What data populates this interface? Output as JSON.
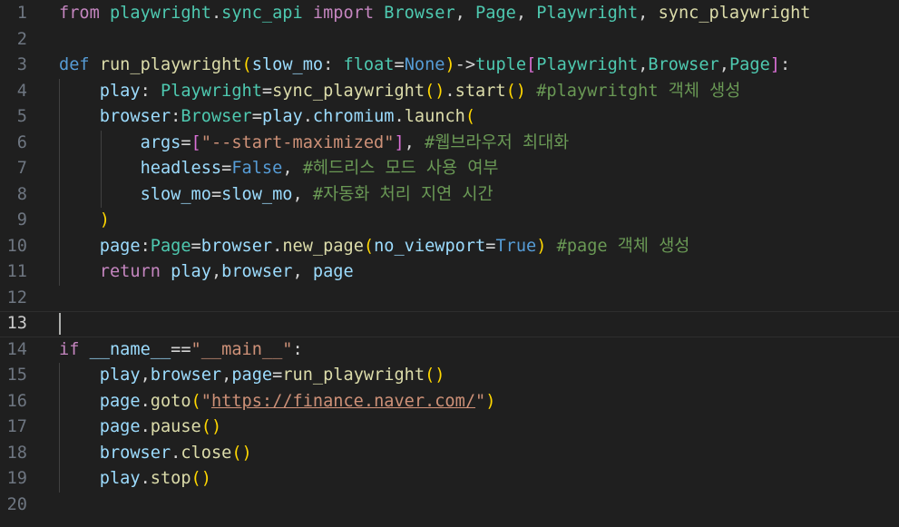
{
  "editor": {
    "language": "python",
    "active_line": 13,
    "colors": {
      "background": "#1f1f1f",
      "line_number": "#6e7681",
      "keyword_control": "#c586c0",
      "keyword": "#569cd6",
      "function": "#dcdcaa",
      "class": "#4ec9b0",
      "variable": "#9cdcfe",
      "string": "#ce9178",
      "comment": "#6a9955"
    },
    "lines": [
      {
        "n": "1",
        "tokens": [
          [
            "kw",
            "from"
          ],
          [
            "pl",
            " "
          ],
          [
            "ty",
            "playwright"
          ],
          [
            "pl",
            "."
          ],
          [
            "ty",
            "sync_api"
          ],
          [
            "pl",
            " "
          ],
          [
            "kw",
            "import"
          ],
          [
            "pl",
            " "
          ],
          [
            "ty",
            "Browser"
          ],
          [
            "pl",
            ", "
          ],
          [
            "ty",
            "Page"
          ],
          [
            "pl",
            ", "
          ],
          [
            "ty",
            "Playwright"
          ],
          [
            "pl",
            ", "
          ],
          [
            "fn",
            "sync_playwright"
          ]
        ]
      },
      {
        "n": "2",
        "tokens": []
      },
      {
        "n": "3",
        "tokens": [
          [
            "st",
            "def"
          ],
          [
            "pl",
            " "
          ],
          [
            "fn",
            "run_playwright"
          ],
          [
            "b1",
            "("
          ],
          [
            "va",
            "slow_mo"
          ],
          [
            "pl",
            ": "
          ],
          [
            "ty",
            "float"
          ],
          [
            "pl",
            "="
          ],
          [
            "st",
            "None"
          ],
          [
            "b1",
            ")"
          ],
          [
            "pl",
            "->"
          ],
          [
            "ty",
            "tuple"
          ],
          [
            "b2",
            "["
          ],
          [
            "ty",
            "Playwright"
          ],
          [
            "pl",
            ","
          ],
          [
            "ty",
            "Browser"
          ],
          [
            "pl",
            ","
          ],
          [
            "ty",
            "Page"
          ],
          [
            "b2",
            "]"
          ],
          [
            "pl",
            ":"
          ]
        ]
      },
      {
        "n": "4",
        "tokens": [
          [
            "pl",
            "    "
          ],
          [
            "va",
            "play"
          ],
          [
            "pl",
            ": "
          ],
          [
            "ty",
            "Playwright"
          ],
          [
            "pl",
            "="
          ],
          [
            "fn",
            "sync_playwright"
          ],
          [
            "b1",
            "()"
          ],
          [
            "pl",
            "."
          ],
          [
            "fn",
            "start"
          ],
          [
            "b1",
            "()"
          ],
          [
            "pl",
            " "
          ],
          [
            "c",
            "#playwritght 객체 생성"
          ]
        ]
      },
      {
        "n": "5",
        "tokens": [
          [
            "pl",
            "    "
          ],
          [
            "va",
            "browser"
          ],
          [
            "pl",
            ":"
          ],
          [
            "ty",
            "Browser"
          ],
          [
            "pl",
            "="
          ],
          [
            "va",
            "play"
          ],
          [
            "pl",
            "."
          ],
          [
            "va",
            "chromium"
          ],
          [
            "pl",
            "."
          ],
          [
            "fn",
            "launch"
          ],
          [
            "b1",
            "("
          ]
        ]
      },
      {
        "n": "6",
        "tokens": [
          [
            "pl",
            "        "
          ],
          [
            "va",
            "args"
          ],
          [
            "pl",
            "="
          ],
          [
            "b2",
            "["
          ],
          [
            "s",
            "\"--start-maximized\""
          ],
          [
            "b2",
            "]"
          ],
          [
            "pl",
            ", "
          ],
          [
            "c",
            "#웹브라우저 최대화"
          ]
        ]
      },
      {
        "n": "7",
        "tokens": [
          [
            "pl",
            "        "
          ],
          [
            "va",
            "headless"
          ],
          [
            "pl",
            "="
          ],
          [
            "st",
            "False"
          ],
          [
            "pl",
            ", "
          ],
          [
            "c",
            "#헤드리스 모드 사용 여부"
          ]
        ]
      },
      {
        "n": "8",
        "tokens": [
          [
            "pl",
            "        "
          ],
          [
            "va",
            "slow_mo"
          ],
          [
            "pl",
            "="
          ],
          [
            "va",
            "slow_mo"
          ],
          [
            "pl",
            ", "
          ],
          [
            "c",
            "#자동화 처리 지연 시간"
          ]
        ]
      },
      {
        "n": "9",
        "tokens": [
          [
            "pl",
            "    "
          ],
          [
            "b1",
            ")"
          ]
        ]
      },
      {
        "n": "10",
        "tokens": [
          [
            "pl",
            "    "
          ],
          [
            "va",
            "page"
          ],
          [
            "pl",
            ":"
          ],
          [
            "ty",
            "Page"
          ],
          [
            "pl",
            "="
          ],
          [
            "va",
            "browser"
          ],
          [
            "pl",
            "."
          ],
          [
            "fn",
            "new_page"
          ],
          [
            "b1",
            "("
          ],
          [
            "va",
            "no_viewport"
          ],
          [
            "pl",
            "="
          ],
          [
            "st",
            "True"
          ],
          [
            "b1",
            ")"
          ],
          [
            "pl",
            " "
          ],
          [
            "c",
            "#page 객체 생성"
          ]
        ]
      },
      {
        "n": "11",
        "tokens": [
          [
            "pl",
            "    "
          ],
          [
            "kw",
            "return"
          ],
          [
            "pl",
            " "
          ],
          [
            "va",
            "play"
          ],
          [
            "pl",
            ","
          ],
          [
            "va",
            "browser"
          ],
          [
            "pl",
            ", "
          ],
          [
            "va",
            "page"
          ]
        ]
      },
      {
        "n": "12",
        "tokens": []
      },
      {
        "n": "13",
        "tokens": []
      },
      {
        "n": "14",
        "tokens": [
          [
            "kw",
            "if"
          ],
          [
            "pl",
            " "
          ],
          [
            "va",
            "__name__"
          ],
          [
            "pl",
            "=="
          ],
          [
            "s",
            "\"__main__\""
          ],
          [
            "pl",
            ":"
          ]
        ]
      },
      {
        "n": "15",
        "tokens": [
          [
            "pl",
            "    "
          ],
          [
            "va",
            "play"
          ],
          [
            "pl",
            ","
          ],
          [
            "va",
            "browser"
          ],
          [
            "pl",
            ","
          ],
          [
            "va",
            "page"
          ],
          [
            "pl",
            "="
          ],
          [
            "fn",
            "run_playwright"
          ],
          [
            "b1",
            "()"
          ]
        ]
      },
      {
        "n": "16",
        "tokens": [
          [
            "pl",
            "    "
          ],
          [
            "va",
            "page"
          ],
          [
            "pl",
            "."
          ],
          [
            "fn",
            "goto"
          ],
          [
            "b1",
            "("
          ],
          [
            "s",
            "\""
          ],
          [
            "su",
            "https://finance.naver.com/"
          ],
          [
            "s",
            "\""
          ],
          [
            "b1",
            ")"
          ]
        ]
      },
      {
        "n": "17",
        "tokens": [
          [
            "pl",
            "    "
          ],
          [
            "va",
            "page"
          ],
          [
            "pl",
            "."
          ],
          [
            "fn",
            "pause"
          ],
          [
            "b1",
            "()"
          ]
        ]
      },
      {
        "n": "18",
        "tokens": [
          [
            "pl",
            "    "
          ],
          [
            "va",
            "browser"
          ],
          [
            "pl",
            "."
          ],
          [
            "fn",
            "close"
          ],
          [
            "b1",
            "()"
          ]
        ]
      },
      {
        "n": "19",
        "tokens": [
          [
            "pl",
            "    "
          ],
          [
            "va",
            "play"
          ],
          [
            "pl",
            "."
          ],
          [
            "fn",
            "stop"
          ],
          [
            "b1",
            "()"
          ]
        ]
      },
      {
        "n": "20",
        "tokens": []
      }
    ]
  }
}
